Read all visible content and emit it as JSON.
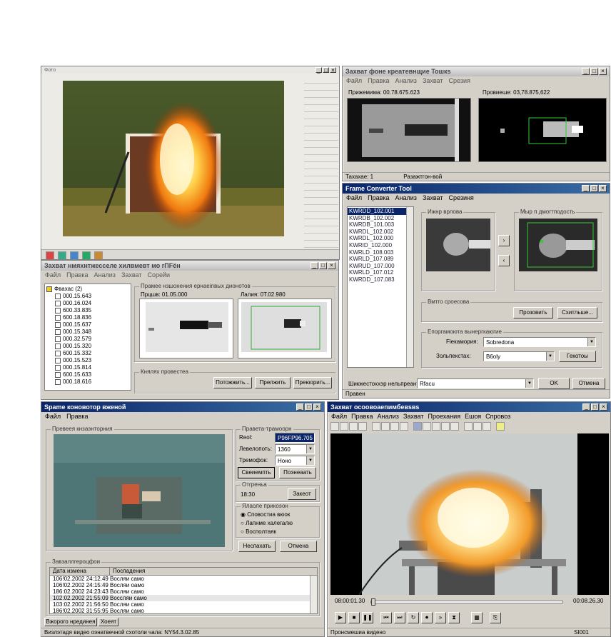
{
  "win_fire": {
    "title": "Фото"
  },
  "win_capture": {
    "title": "Захват фоне креатевнщие Toшкs",
    "menu": [
      "Файл",
      "Правка",
      "Анализ",
      "Захват",
      "Срезия"
    ],
    "left_label": "Прижемима: 00.78.675.623",
    "right_label": "Провиеше: 03,78.875,622",
    "status": [
      "Тахахае: 1",
      "Разажтгон-вой"
    ]
  },
  "win_tree": {
    "title": "Захват нмяхнтжесселе хилвмевт мо rПFён",
    "menu": [
      "Файл",
      "Правка",
      "Анализ",
      "Захват",
      "Сорейи"
    ],
    "files_root": "Фвахас (2)",
    "files": [
      "000.15.643",
      "000.16.024",
      "600.33.835",
      "600.18.836",
      "000.15.637",
      "000.15.348",
      "000.32.579",
      "000.15.320",
      "600.15.332",
      "000.15.523",
      "000.15.814",
      "600.15.633",
      "000.18.616"
    ],
    "preview_group": "Прамее нзшонения ернаеinвых дионотов",
    "frame_a": "Прцшв: 01.05.000",
    "frame_b": "Лалия: 0Т.02.980",
    "nav_group": "Княлях провестеа",
    "buttons": [
      "Потожжить...",
      "Прелжить",
      "Преюорить..."
    ]
  },
  "win_frame": {
    "title": "Frame Converter Tool",
    "menu": [
      "Файл",
      "Правка",
      "Анализ",
      "Захват",
      "Срезиня"
    ],
    "files": [
      "KWRDD_102.001",
      "KWRDB_102.002",
      "KWRDB_101.003",
      "KWRDL_102.002",
      "KWRDL_102.000",
      "KWRID_102.000",
      "KWRLD_108.003",
      "KWRLD_107.089",
      "KWRUD_107.000",
      "KWRLD_107.012",
      "KWRDD_107.083"
    ],
    "src_group": "Ижнр врлова",
    "dst_group": "Мыр п дмогтподость",
    "opts_group": "Вмтго сроесова",
    "preview_btn": "Прозовить",
    "convert_btn": "Схитльше...",
    "fmt_group": "Епоргамоюта вынергкаюгие",
    "fmt_label": "Fiекамория:",
    "fmt_value": "Sobredona",
    "res_label": "Зольпекстах:",
    "res_value": "B6oly",
    "res_btn": "Гекотоы",
    "out_label": "Шикжестоххэр нельпреанта:",
    "out_value": "Rfacu",
    "ok": "OK",
    "cancel": "Отмена",
    "status": "Правен"
  },
  "win_conv": {
    "title": "Spame коновотор вженой",
    "menu": [
      "Файл",
      "Правка"
    ],
    "preview_group": "Превеея кнзаэнторния",
    "params_group": "Правета-трамоорн",
    "res_label": "Reol:",
    "res_value": "P96FP96.705",
    "lvl_label": "Левелопоть:",
    "lvl_value": "1360",
    "trem_label": "Тремофок:",
    "trem_value": "Ноно",
    "btn_apply": "Свеиемпть",
    "btn_show": "Поэнеаать",
    "time_group": "Отгреньа",
    "time_value": "18:30",
    "time_btn": "Закеот",
    "mode_group": "Ялаоле прикоэон",
    "radios": [
      "Сповостиа вюок",
      "Лапнме халегалю",
      "Восполтаяк"
    ],
    "btn_reset": "Неспахать",
    "btn_cancel": "Отмена",
    "log_group": "Завзаллгероцфои",
    "cols": [
      "Дата измена",
      "Поспадения"
    ],
    "rows": [
      [
        "106!02.2002 24:12.49",
        "Восляи само"
      ],
      [
        "106!02.2002 24:15:49",
        "Восляи оамо"
      ],
      [
        "186:02.2002 24:23:43",
        "Восляи само"
      ],
      [
        "102:02.2002 21:55:09",
        "Воссляи само"
      ],
      [
        "103:02.2002 21:56:50",
        "Восляи само"
      ],
      [
        "186!02.2002 31:55:95",
        "Восляи само"
      ]
    ],
    "status": "Визлэтадя видео оэнатвечной схотоли чала: NY54.3.02.85",
    "tab_a": "Вжорого нрединея",
    "tab_b": "Хоеят"
  },
  "win_video": {
    "title": "Захват осоовоаепимбевsвs",
    "menu": [
      "Файл",
      "Правка",
      "Анализ",
      "Захват",
      "Проехания",
      "Ешоя",
      "Спровоз"
    ],
    "time_start": "08:00:01.30",
    "time_end": "00:08.26.30",
    "status": "Пронсмешиа видено",
    "status_right": "SI001"
  }
}
